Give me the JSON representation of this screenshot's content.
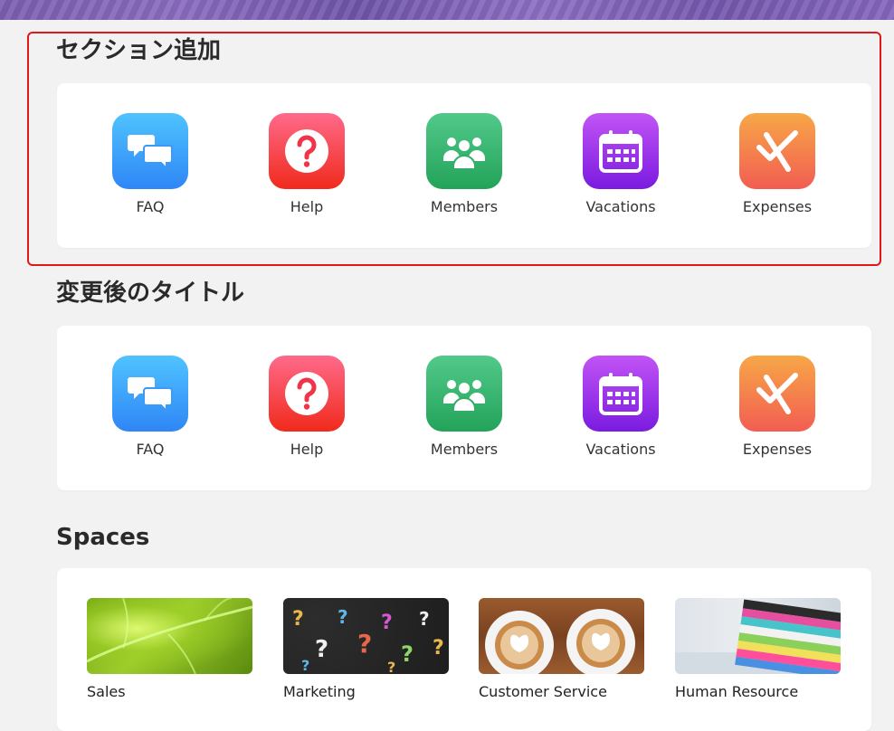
{
  "sections": [
    {
      "title": "セクション追加",
      "apps": [
        {
          "label": "FAQ"
        },
        {
          "label": "Help"
        },
        {
          "label": "Members"
        },
        {
          "label": "Vacations"
        },
        {
          "label": "Expenses"
        }
      ]
    },
    {
      "title": "変更後のタイトル",
      "apps": [
        {
          "label": "FAQ"
        },
        {
          "label": "Help"
        },
        {
          "label": "Members"
        },
        {
          "label": "Vacations"
        },
        {
          "label": "Expenses"
        }
      ]
    }
  ],
  "spaces": {
    "title": "Spaces",
    "items": [
      {
        "label": "Sales"
      },
      {
        "label": "Marketing"
      },
      {
        "label": "Customer Service"
      },
      {
        "label": "Human Resource"
      }
    ]
  },
  "colors": {
    "highlight_border": "#e01818",
    "faq": "#2f86f6",
    "help": "#f02a1c",
    "members": "#23a35a",
    "vacations": "#7a1be0",
    "expenses": "#f25d52"
  },
  "icons": [
    "chat-bubbles-icon",
    "question-icon",
    "people-group-icon",
    "calendar-icon",
    "expenses-check-icon"
  ]
}
